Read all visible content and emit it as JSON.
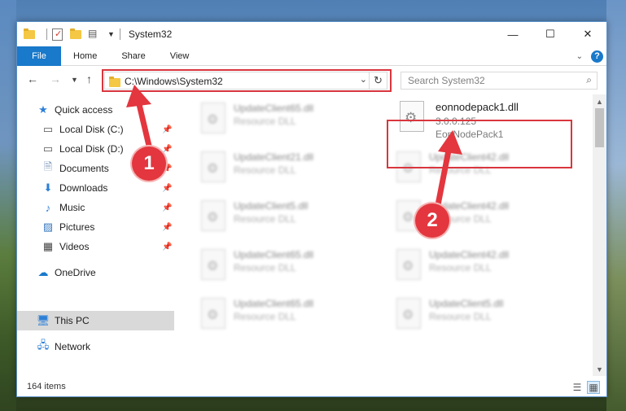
{
  "window": {
    "title": "System32",
    "controls": {
      "minimize": "—",
      "maximize": "☐",
      "close": "✕"
    }
  },
  "ribbon": {
    "file_tab": "File",
    "tabs": [
      "Home",
      "Share",
      "View"
    ],
    "help": "?"
  },
  "address_bar": {
    "path": "C:\\Windows\\System32",
    "search_placeholder": "Search System32"
  },
  "nav_pane": {
    "items": [
      {
        "label": "Quick access",
        "icon": "star-icon",
        "pinned": false
      },
      {
        "label": "Local Disk (C:)",
        "icon": "drive-icon",
        "pinned": true
      },
      {
        "label": "Local Disk (D:)",
        "icon": "drive-icon",
        "pinned": true
      },
      {
        "label": "Documents",
        "icon": "documents-icon",
        "pinned": true
      },
      {
        "label": "Downloads",
        "icon": "download-arrow-icon",
        "pinned": true
      },
      {
        "label": "Music",
        "icon": "music-note-icon",
        "pinned": true
      },
      {
        "label": "Pictures",
        "icon": "pictures-icon",
        "pinned": true
      },
      {
        "label": "Videos",
        "icon": "film-icon",
        "pinned": true
      },
      {
        "label": "OneDrive",
        "icon": "cloud-icon",
        "pinned": false
      },
      {
        "label": "This PC",
        "icon": "monitor-icon",
        "pinned": false,
        "selected": true
      },
      {
        "label": "Network",
        "icon": "network-icon",
        "pinned": false
      }
    ]
  },
  "files": [
    {
      "name": "UpdateClient65.dll",
      "type": "Resource DLL"
    },
    {
      "name": "UpdateClient21.dll",
      "type": "Resource DLL"
    },
    {
      "name": "UpdateClient42.dll",
      "type": "Resource DLL"
    },
    {
      "name": "UpdateClient5.dll",
      "type": "Resource DLL"
    },
    {
      "name": "UpdateClient42.dll",
      "type": "Resource DLL"
    },
    {
      "name": "UpdateClient65.dll",
      "type": "Resource DLL"
    },
    {
      "name": "UpdateClient42.dll",
      "type": "Resource DLL"
    },
    {
      "name": "UpdateClient65.dll",
      "type": "Resource DLL"
    },
    {
      "name": "UpdateClient5.dll",
      "type": "Resource DLL"
    }
  ],
  "target_file": {
    "name": "eonnodepack1.dll",
    "version": "3.0.0.125",
    "description": "EonNodePack1"
  },
  "status": {
    "item_count": "164 items"
  },
  "annotations": {
    "step1": "1",
    "step2": "2",
    "color": "#e3363e"
  }
}
